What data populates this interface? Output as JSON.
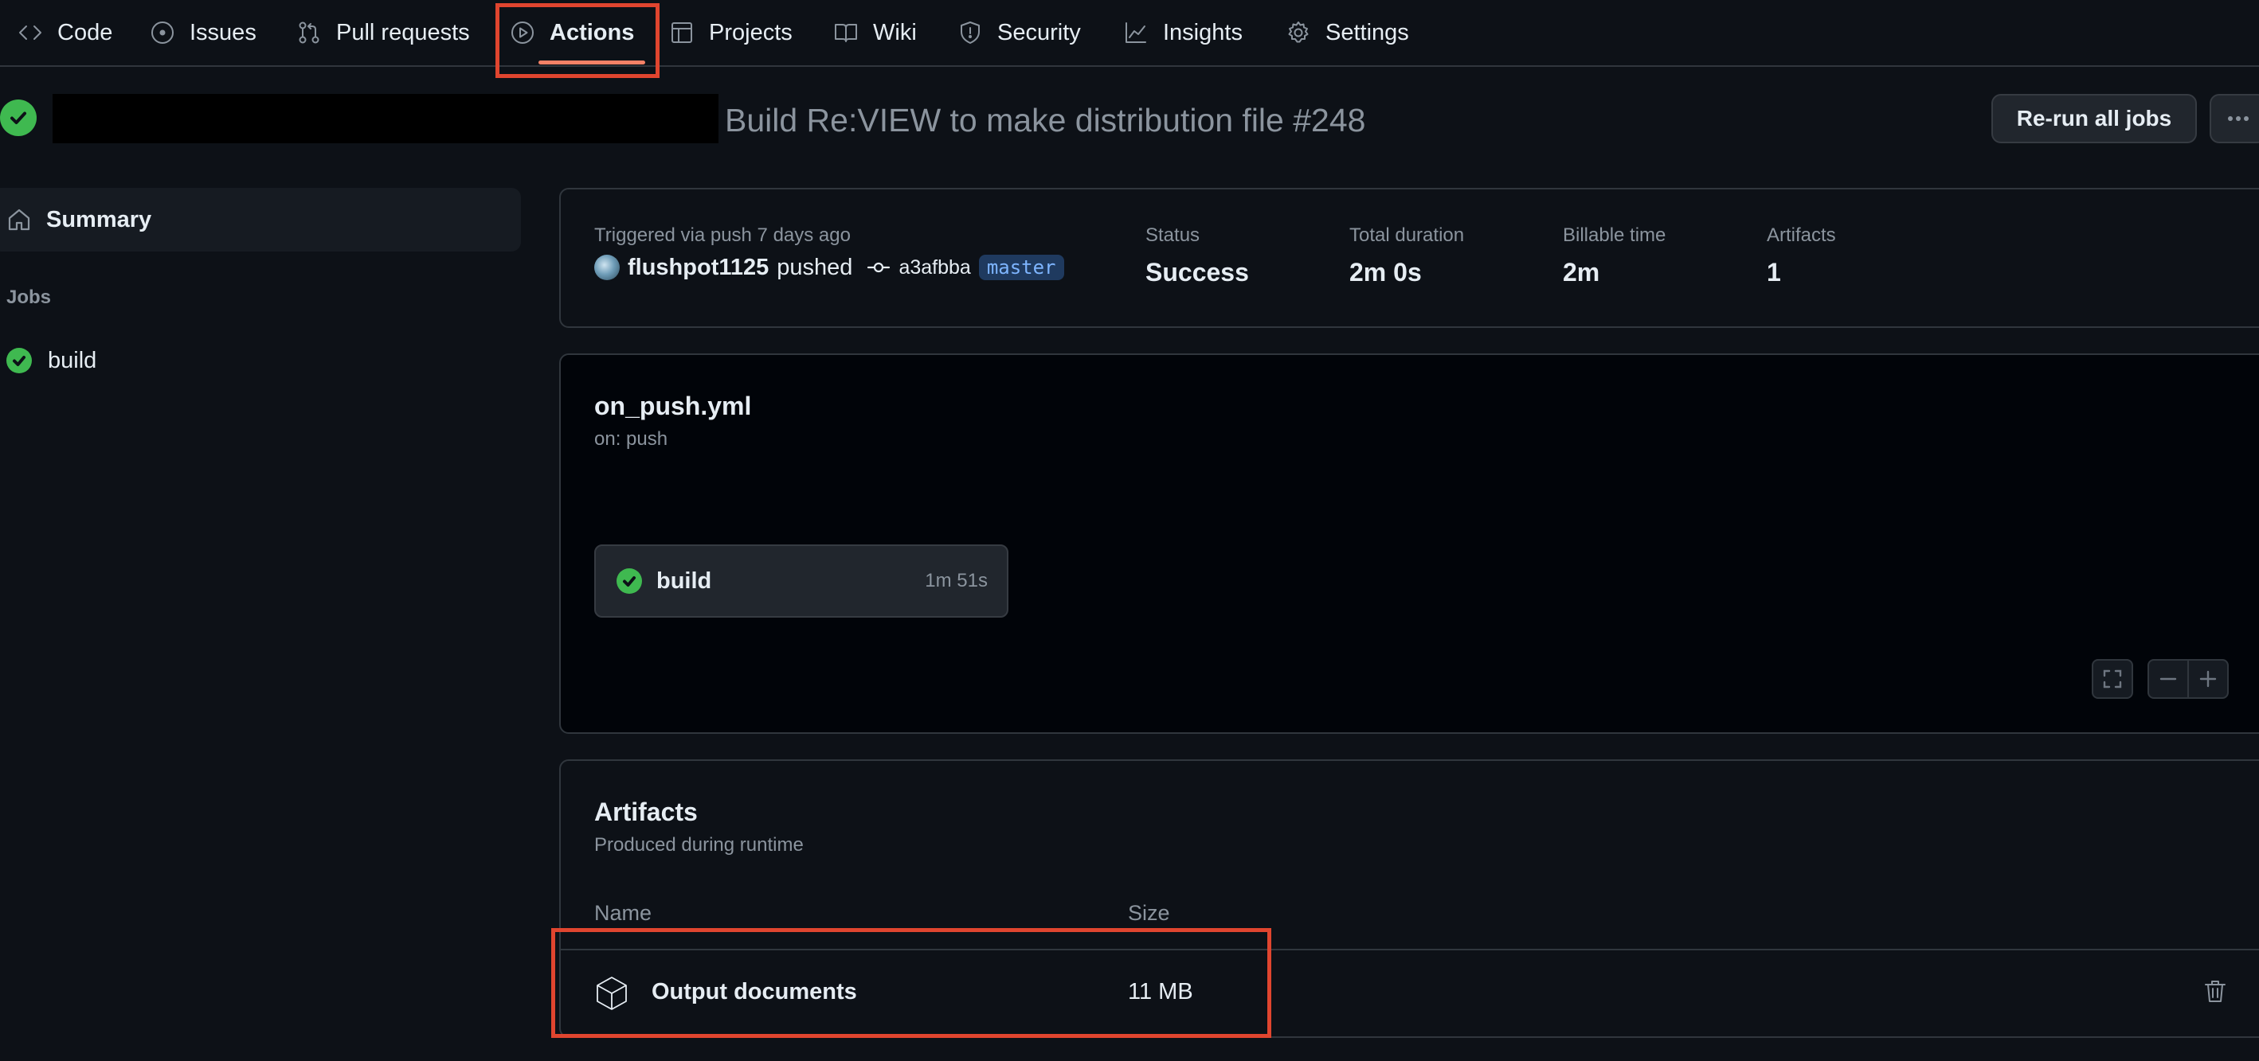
{
  "nav": {
    "items": [
      {
        "label": "Code",
        "icon": "code-icon"
      },
      {
        "label": "Issues",
        "icon": "issue-circle-icon"
      },
      {
        "label": "Pull requests",
        "icon": "pull-request-icon"
      },
      {
        "label": "Actions",
        "icon": "play-circle-icon",
        "active": true
      },
      {
        "label": "Projects",
        "icon": "table-icon"
      },
      {
        "label": "Wiki",
        "icon": "book-icon"
      },
      {
        "label": "Security",
        "icon": "shield-icon"
      },
      {
        "label": "Insights",
        "icon": "graph-icon"
      },
      {
        "label": "Settings",
        "icon": "gear-icon"
      }
    ]
  },
  "run": {
    "title": "Build Re:VIEW to make distribution file #248",
    "status_icon": "check-circle-icon",
    "rerun_label": "Re-run all jobs"
  },
  "sidebar": {
    "summary_label": "Summary",
    "jobs_label": "Jobs",
    "jobs": [
      {
        "label": "build",
        "status": "success"
      }
    ]
  },
  "summary": {
    "trigger_text": "Triggered via push 7 days ago",
    "user": "flushpot1125",
    "action": "pushed",
    "commit": "a3afbba",
    "branch": "master",
    "stats": [
      {
        "label": "Status",
        "value": "Success"
      },
      {
        "label": "Total duration",
        "value": "2m 0s"
      },
      {
        "label": "Billable time",
        "value": "2m"
      },
      {
        "label": "Artifacts",
        "value": "1"
      }
    ]
  },
  "workflow": {
    "file": "on_push.yml",
    "trigger": "on: push",
    "job": {
      "name": "build",
      "duration": "1m 51s"
    }
  },
  "artifacts": {
    "title": "Artifacts",
    "subtitle": "Produced during runtime",
    "col_name": "Name",
    "col_size": "Size",
    "items": [
      {
        "name": "Output documents",
        "size": "11 MB"
      }
    ]
  },
  "colors": {
    "background": "#0d1117",
    "success": "#3fb950",
    "highlight_box": "#e0452f",
    "active_tab_underline": "#f78166"
  }
}
